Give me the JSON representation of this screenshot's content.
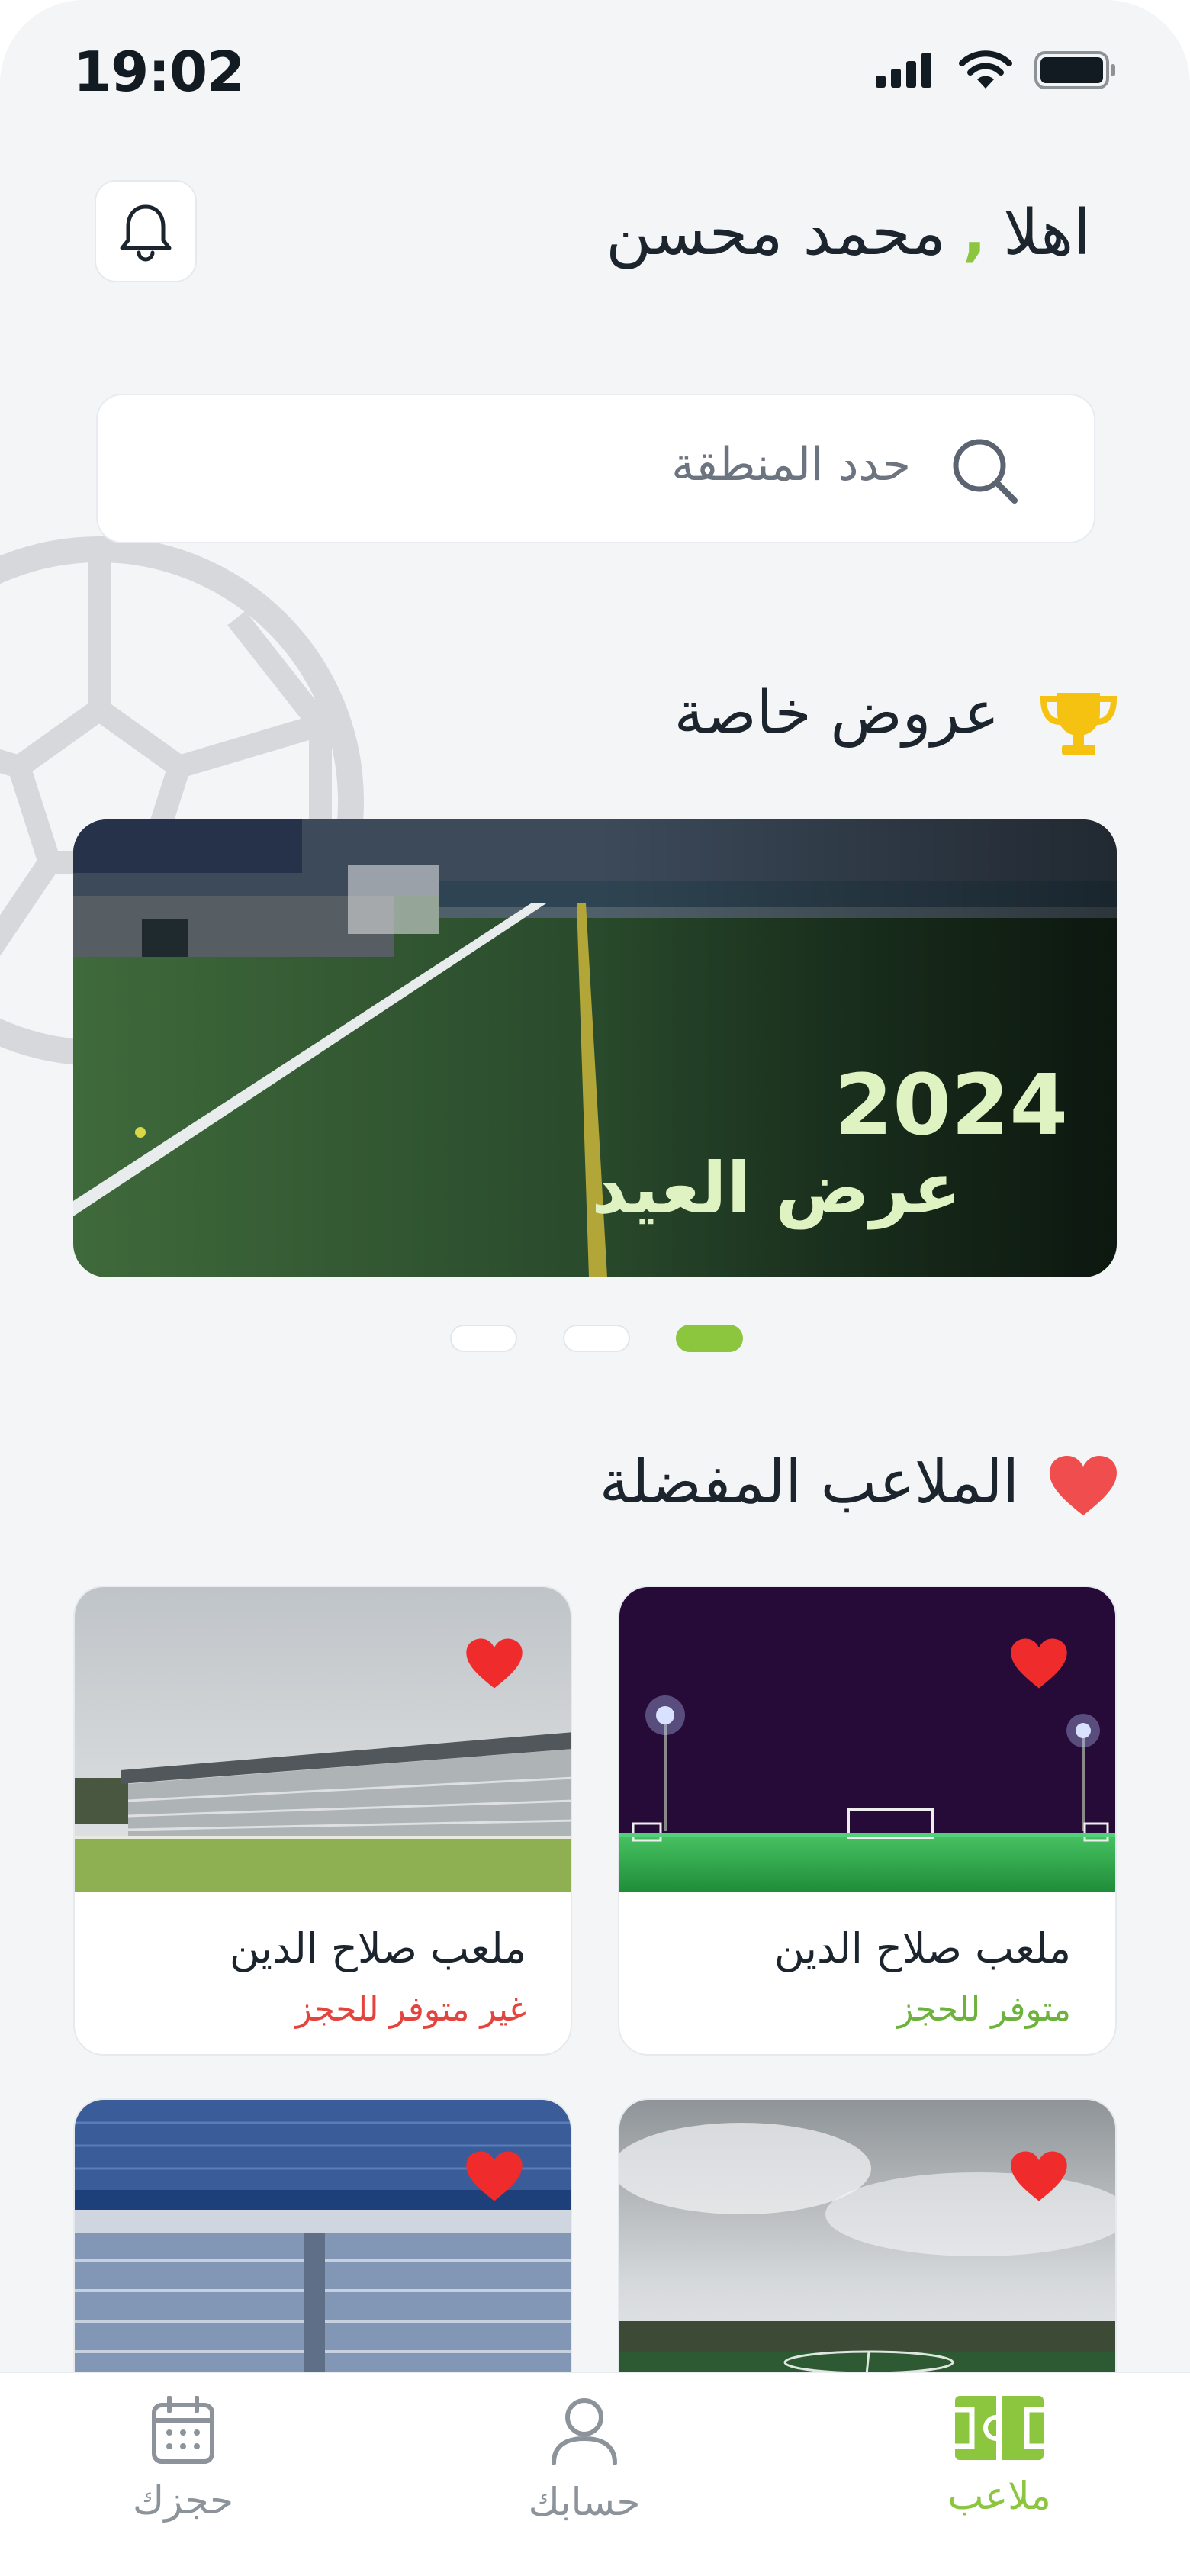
{
  "status_bar": {
    "time": "19:02"
  },
  "header": {
    "greeting_prefix": "اهلا",
    "greeting_separator": ",",
    "user_name": "محمد محسن"
  },
  "search": {
    "placeholder": "حدد المنطقة"
  },
  "offers": {
    "section_title": "عروض خاصة",
    "banner": {
      "year": "2024",
      "title": "عرض العيد"
    },
    "carousel": {
      "count": 3,
      "active_index": 0
    }
  },
  "favorites": {
    "section_title": "الملاعب المفضلة",
    "cards": [
      {
        "name": "ملعب صلاح الدين",
        "status": "متوفر للحجز",
        "available": true
      },
      {
        "name": "ملعب صلاح الدين",
        "status": "غير متوفر للحجز",
        "available": false
      },
      {
        "name": "",
        "status": "",
        "available": null
      },
      {
        "name": "",
        "status": "",
        "available": null
      }
    ]
  },
  "bottom_nav": {
    "items": [
      {
        "label": "ملاعب",
        "icon": "field-icon",
        "active": true
      },
      {
        "label": "حسابك",
        "icon": "user-icon",
        "active": false
      },
      {
        "label": "حجزك",
        "icon": "calendar-icon",
        "active": false
      }
    ]
  },
  "colors": {
    "accent": "#8cc63f",
    "heart": "#ef2b2b",
    "unavailable": "#e3453e",
    "trophy": "#f5c211",
    "background": "#f3f5f7"
  }
}
